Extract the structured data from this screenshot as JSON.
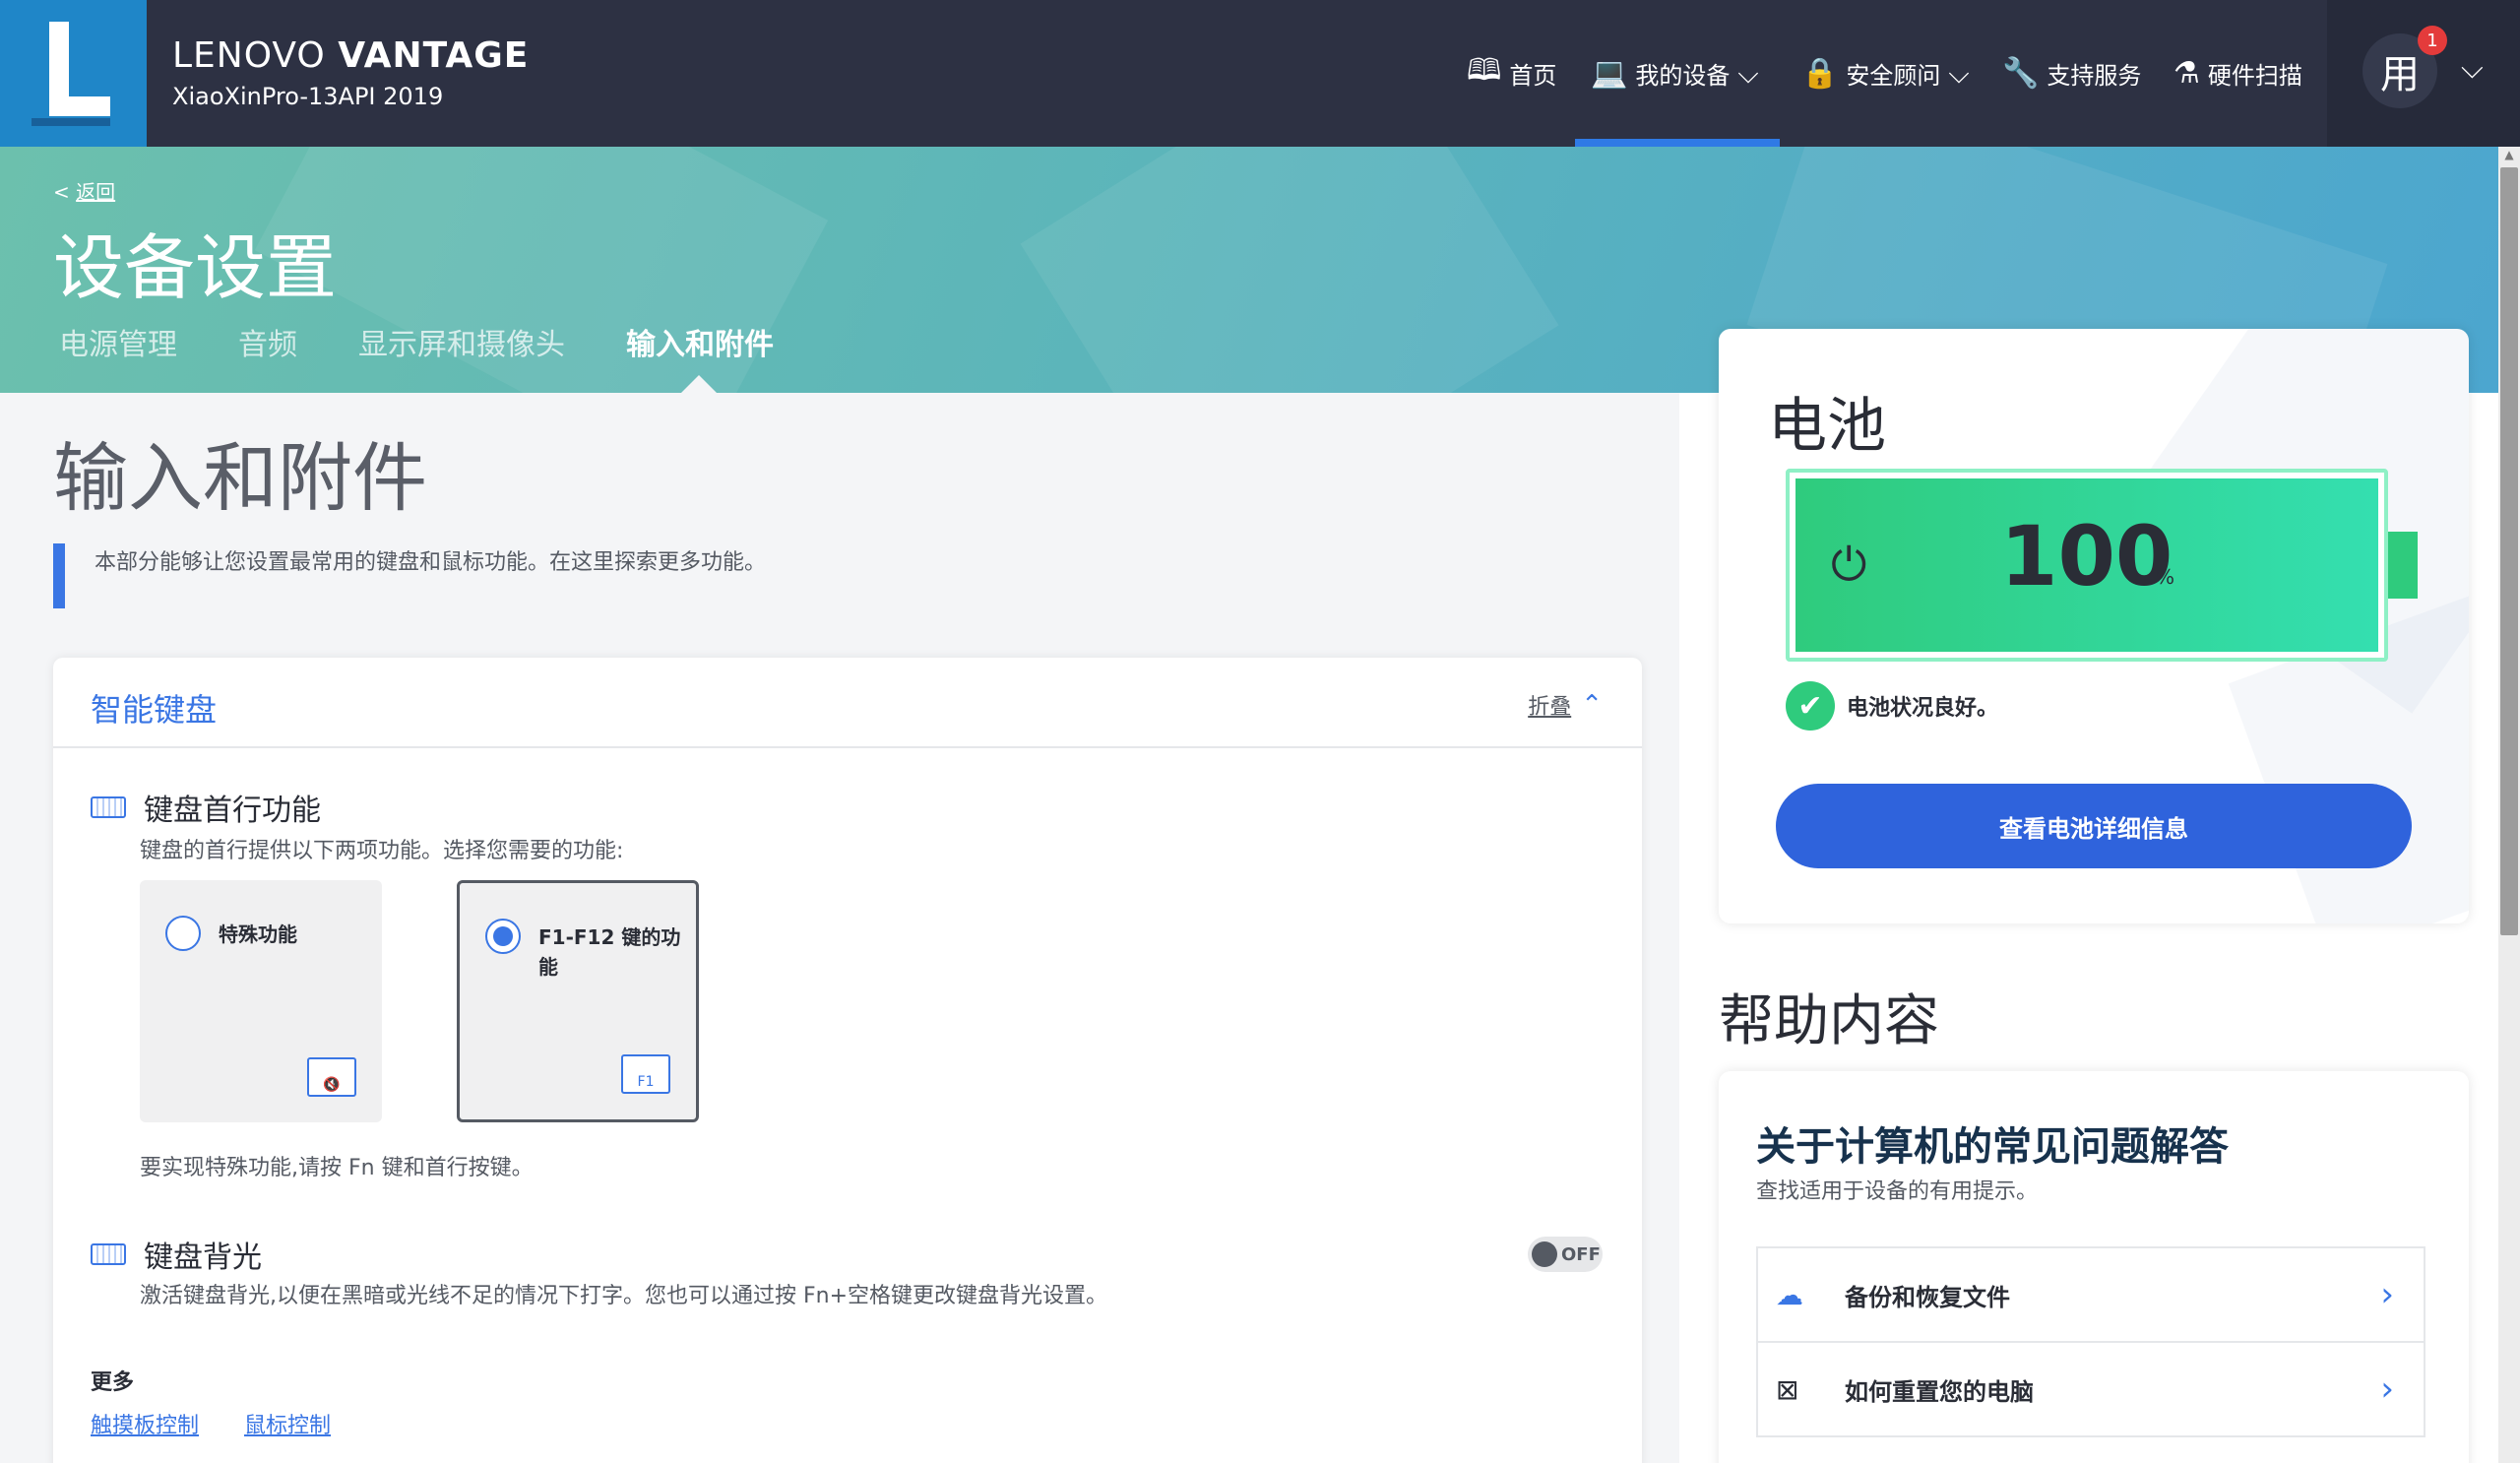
{
  "header": {
    "brand_prefix": "LENOVO",
    "brand_name": "VANTAGE",
    "device": "XiaoXinPro-13API 2019",
    "nav": [
      {
        "label": "首页",
        "icon": "book-icon",
        "has_menu": false
      },
      {
        "label": "我的设备",
        "icon": "laptop-icon",
        "has_menu": true,
        "active": true
      },
      {
        "label": "安全顾问",
        "icon": "lock-icon",
        "has_menu": true
      },
      {
        "label": "支持服务",
        "icon": "wrench-icon",
        "has_menu": false
      },
      {
        "label": "硬件扫描",
        "icon": "flask-icon",
        "has_menu": false
      }
    ],
    "user_avatar": "用",
    "notification_count": "1"
  },
  "hero": {
    "back": "返回",
    "title": "设备设置",
    "tabs": [
      "电源管理",
      "音频",
      "显示屏和摄像头",
      "输入和附件"
    ],
    "active_tab": "输入和附件"
  },
  "main": {
    "section_title": "输入和附件",
    "intro": "本部分能够让您设置最常用的键盘和鼠标功能。在这里探索更多功能。",
    "card": {
      "title": "智能键盘",
      "collapse_label": "折叠",
      "top_row": {
        "title": "键盘首行功能",
        "desc": "键盘的首行提供以下两项功能。选择您需要的功能:",
        "options": [
          {
            "label": "特殊功能",
            "selected": false,
            "key_icon": "mute-icon",
            "key_text": ""
          },
          {
            "label": "F1-F12 键的功能",
            "selected": true,
            "key_icon": "f1-key-icon",
            "key_text": "F1"
          }
        ],
        "hint": "要实现特殊功能,请按 Fn 键和首行按键。"
      },
      "backlight": {
        "title": "键盘背光",
        "desc": "激活键盘背光,以便在黑暗或光线不足的情况下打字。您也可以通过按 Fn+空格键更改键盘背光设置。",
        "toggle_label": "OFF",
        "enabled": false
      },
      "more": {
        "title": "更多",
        "links": [
          "触摸板控制",
          "鼠标控制"
        ]
      }
    }
  },
  "battery": {
    "title": "电池",
    "percent": "100",
    "percent_unit": "%",
    "level": 100,
    "status": "电池状况良好。",
    "details_button": "查看电池详细信息",
    "fill_color": "#2fcb7d"
  },
  "help": {
    "title": "帮助内容",
    "faq_title": "关于计算机的常见问题解答",
    "faq_sub": "查找适用于设备的有用提示。",
    "items": [
      {
        "label": "备份和恢复文件",
        "icon": "cloud-upload-icon"
      },
      {
        "label": "如何重置您的电脑",
        "icon": "reset-icon"
      }
    ]
  },
  "colors": {
    "accent": "#3a76e4",
    "topbar": "#2d3143",
    "battery_green": "#2fcb7d"
  }
}
